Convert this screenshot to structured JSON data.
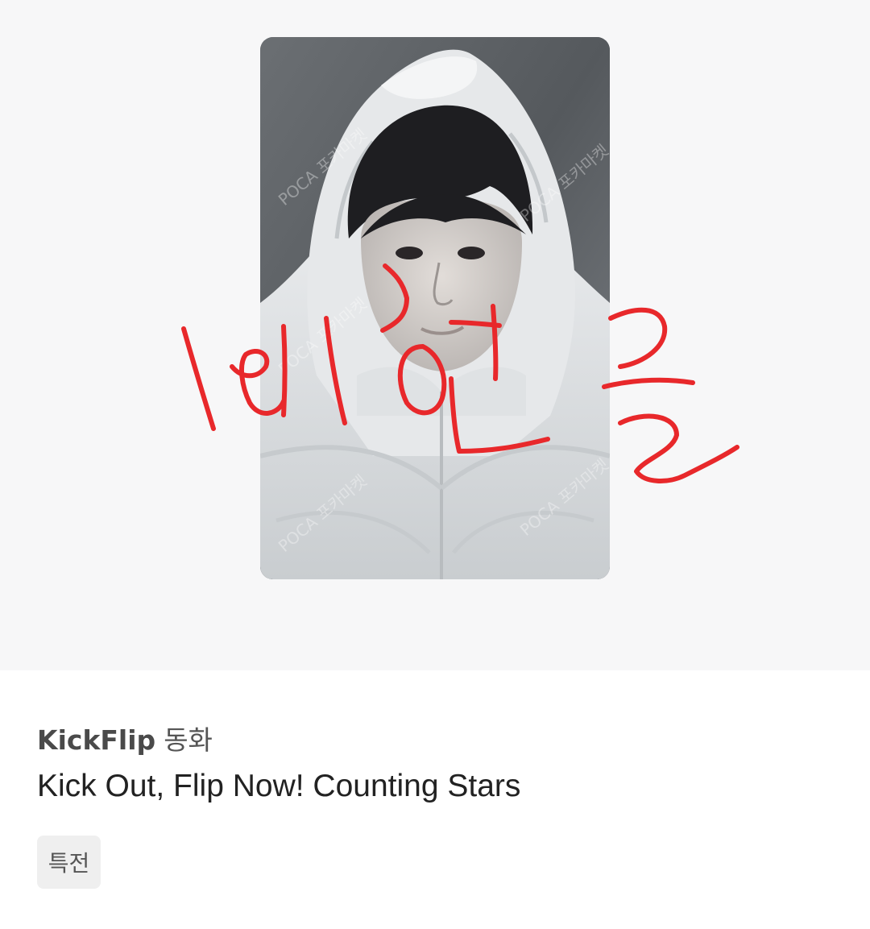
{
  "product": {
    "image_alt": "photocard",
    "watermark_text": "POCA 포카마켓",
    "handwritten_mark": "비공판"
  },
  "info": {
    "artist": "KickFlip",
    "member": "동화",
    "album_title": "Kick Out, Flip Now! Counting Stars",
    "tags": [
      "특전"
    ]
  },
  "colors": {
    "image_background": "#f7f7f8",
    "scribble": "#e8282b",
    "tag_background": "#efefef"
  }
}
